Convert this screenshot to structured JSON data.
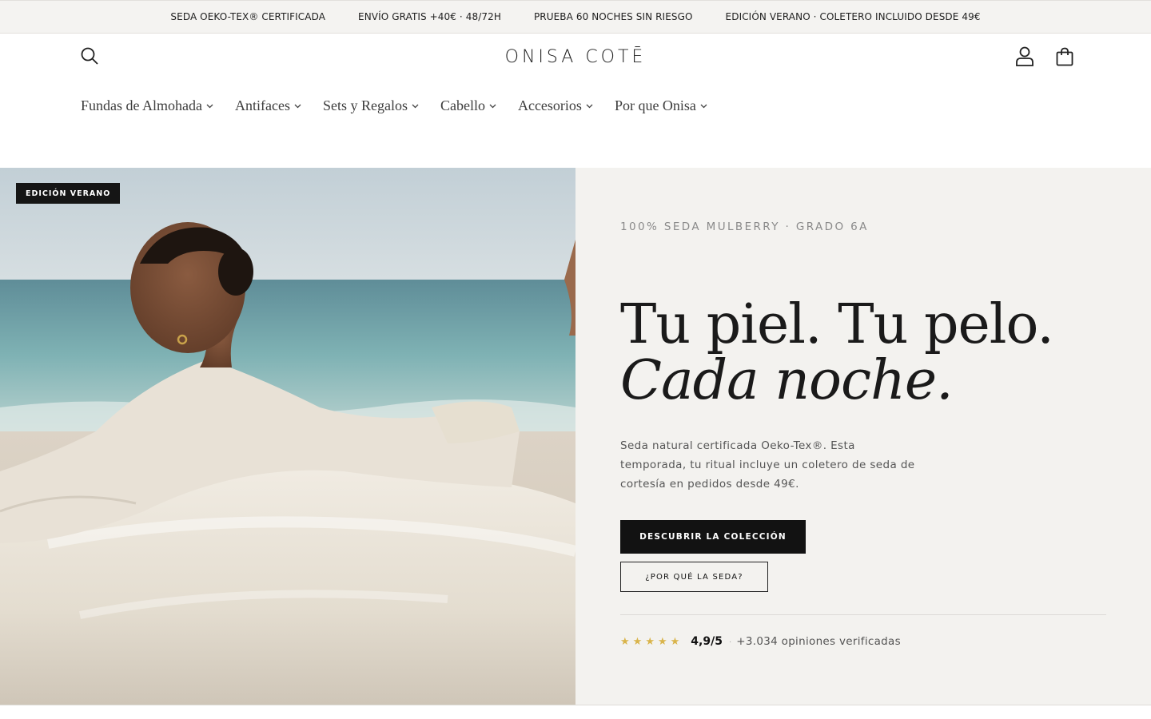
{
  "announcement_bar": {
    "items": [
      "SEDA OEKO-TEX® CERTIFICADA",
      "ENVÍO GRATIS +40€ · 48/72H",
      "PRUEBA 60 NOCHES SIN RIESGO",
      "EDICIÓN VERANO · COLETERO INCLUIDO DESDE 49€"
    ]
  },
  "header": {
    "logo_text": "ONISA COTĒ",
    "icons": {
      "search": "search-icon",
      "account": "user-icon",
      "cart": "bag-icon"
    }
  },
  "nav": {
    "items": [
      {
        "label": "Fundas de Almohada"
      },
      {
        "label": "Antifaces"
      },
      {
        "label": "Sets y Regalos"
      },
      {
        "label": "Cabello"
      },
      {
        "label": "Accesorios"
      },
      {
        "label": "Por que Onisa"
      }
    ]
  },
  "hero": {
    "badge": "EDICIÓN VERANO",
    "eyebrow": "100% SEDA MULBERRY · GRADO 6A",
    "title_line1": "Tu piel. Tu pelo.",
    "title_line2": "Cada noche.",
    "body": "Seda natural certificada Oeko-Tex®. Esta temporada, tu ritual incluye un coletero de seda de cortesía en pedidos desde 49€.",
    "cta_primary": "DESCUBRIR LA COLECCIÓN",
    "cta_secondary": "¿POR QUÉ LA SEDA?",
    "rating": {
      "stars": 5,
      "score": "4,9/5",
      "separator": "·",
      "reviews": "+3.034 opiniones verificadas"
    }
  },
  "colors": {
    "announcement_bg": "#f4f3f1",
    "hero_text_bg": "#f3f2ef",
    "primary_button": "#121212",
    "star": "#d9b44a"
  }
}
